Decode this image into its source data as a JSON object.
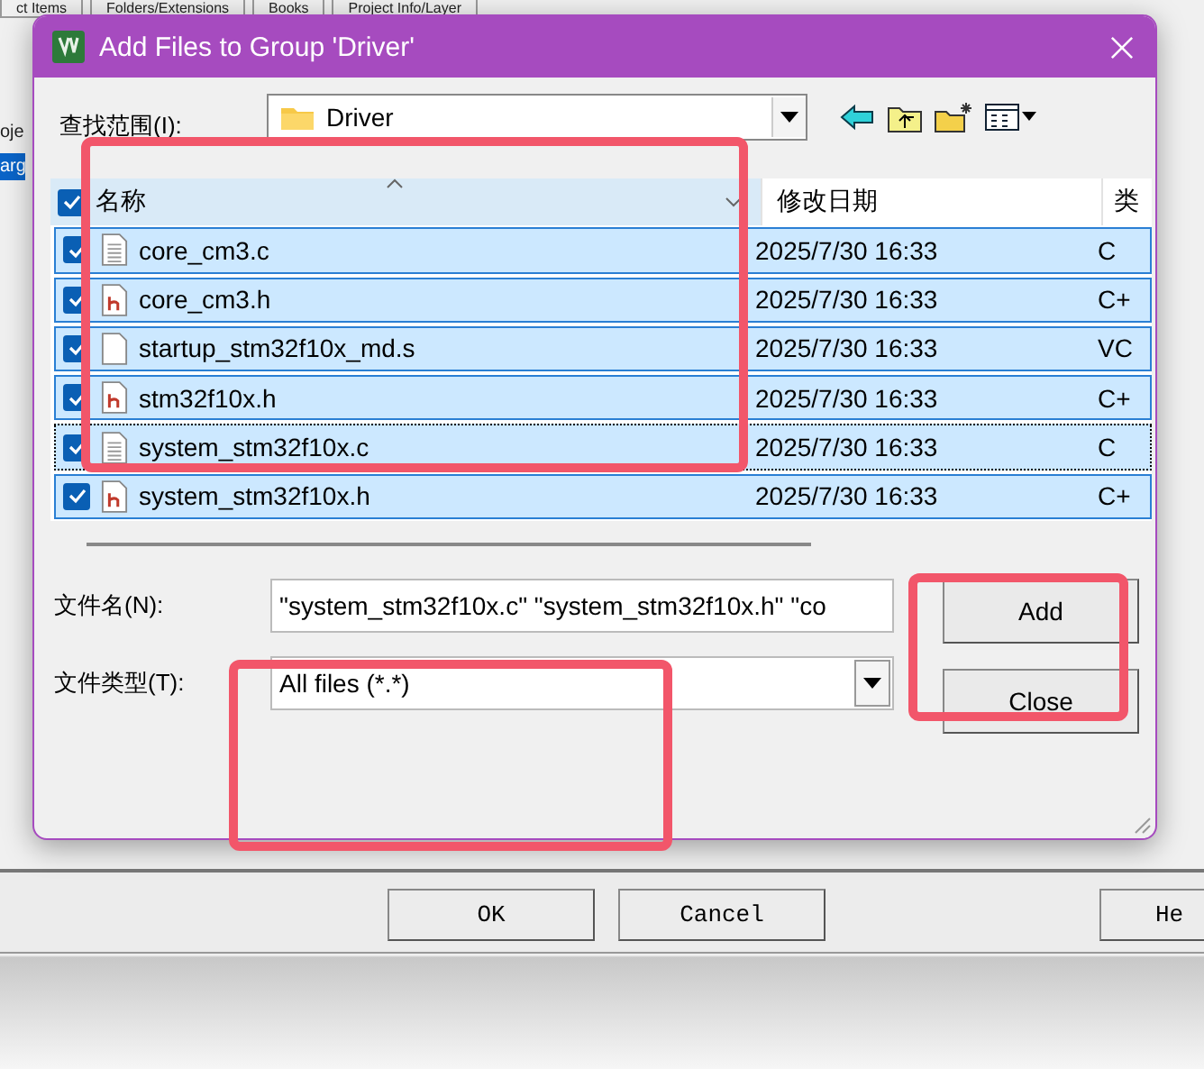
{
  "background_window": {
    "tabs": [
      "ct Items",
      "Folders/Extensions",
      "Books",
      "Project Info/Layer"
    ],
    "list_items": [
      {
        "label": "oje",
        "selected": false
      },
      {
        "label": "arg",
        "selected": true
      }
    ],
    "buttons": [
      "OK",
      "Cancel",
      "He"
    ]
  },
  "dialog": {
    "title": "Add Files to Group 'Driver'",
    "look_in": {
      "label": "查找范围(I):",
      "value": "Driver"
    },
    "file_list": {
      "columns": [
        "名称",
        "修改日期",
        "类"
      ],
      "all_checked": true,
      "rows": [
        {
          "name": "core_cm3.c",
          "kind": "c",
          "modified": "2025/7/30 16:33",
          "type": "C",
          "checked": true,
          "selected": true,
          "focused": false
        },
        {
          "name": "core_cm3.h",
          "kind": "h",
          "modified": "2025/7/30 16:33",
          "type": "C+",
          "checked": true,
          "selected": true,
          "focused": false
        },
        {
          "name": "startup_stm32f10x_md.s",
          "kind": "s",
          "modified": "2025/7/30 16:33",
          "type": "VC",
          "checked": true,
          "selected": true,
          "focused": false
        },
        {
          "name": "stm32f10x.h",
          "kind": "h",
          "modified": "2025/7/30 16:33",
          "type": "C+",
          "checked": true,
          "selected": true,
          "focused": false
        },
        {
          "name": "system_stm32f10x.c",
          "kind": "c",
          "modified": "2025/7/30 16:33",
          "type": "C",
          "checked": true,
          "selected": true,
          "focused": true
        },
        {
          "name": "system_stm32f10x.h",
          "kind": "h",
          "modified": "2025/7/30 16:33",
          "type": "C+",
          "checked": true,
          "selected": true,
          "focused": false
        }
      ]
    },
    "file_name": {
      "label": "文件名(N):",
      "value": "\"system_stm32f10x.c\" \"system_stm32f10x.h\" \"co"
    },
    "file_type": {
      "label": "文件类型(T):",
      "value": "All files (*.*)"
    },
    "buttons": [
      "Add",
      "Close"
    ]
  }
}
